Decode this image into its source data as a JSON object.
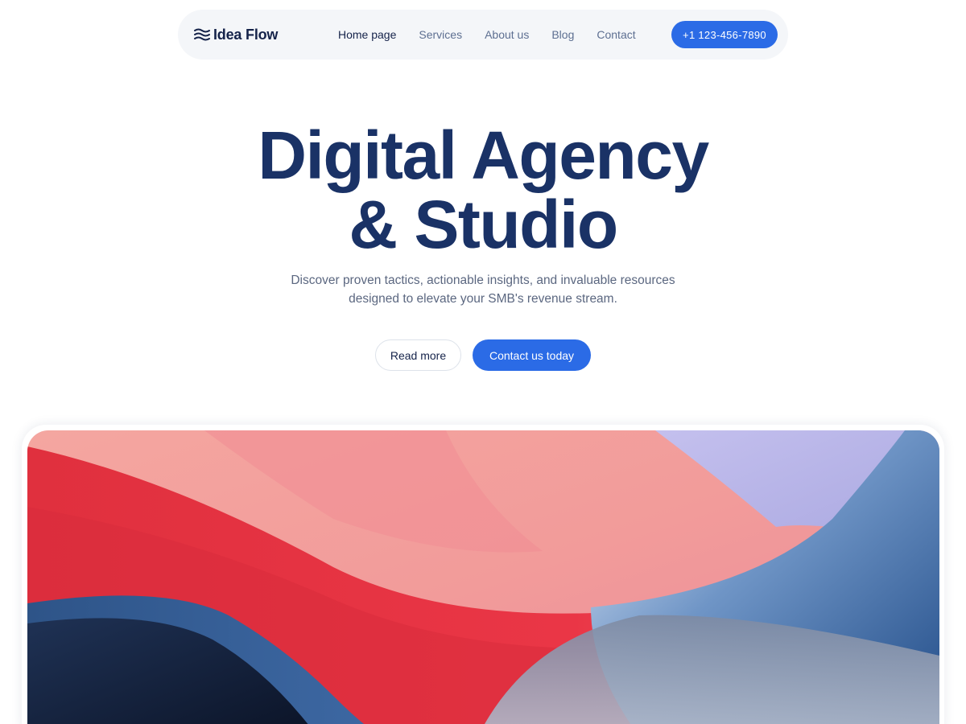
{
  "nav": {
    "brand": "Idea Flow",
    "brand_icon": "waves-icon",
    "links": [
      {
        "label": "Home page",
        "active": true
      },
      {
        "label": "Services",
        "active": false
      },
      {
        "label": "About us",
        "active": false
      },
      {
        "label": "Blog",
        "active": false
      },
      {
        "label": "Contact",
        "active": false
      }
    ],
    "phone": "+1 123-456-7890"
  },
  "hero": {
    "title_line1": "Digital Agency",
    "title_line2": "& Studio",
    "subtitle_line1": "Discover proven tactics, actionable insights, and invaluable resources",
    "subtitle_line2": "designed to elevate your SMB's revenue stream.",
    "secondary_cta": "Read more",
    "primary_cta": "Contact us today"
  },
  "colors": {
    "accent": "#2b6be6",
    "heading": "#1a3266",
    "nav_bg": "#f4f6f9",
    "body_text": "#5b6780"
  }
}
